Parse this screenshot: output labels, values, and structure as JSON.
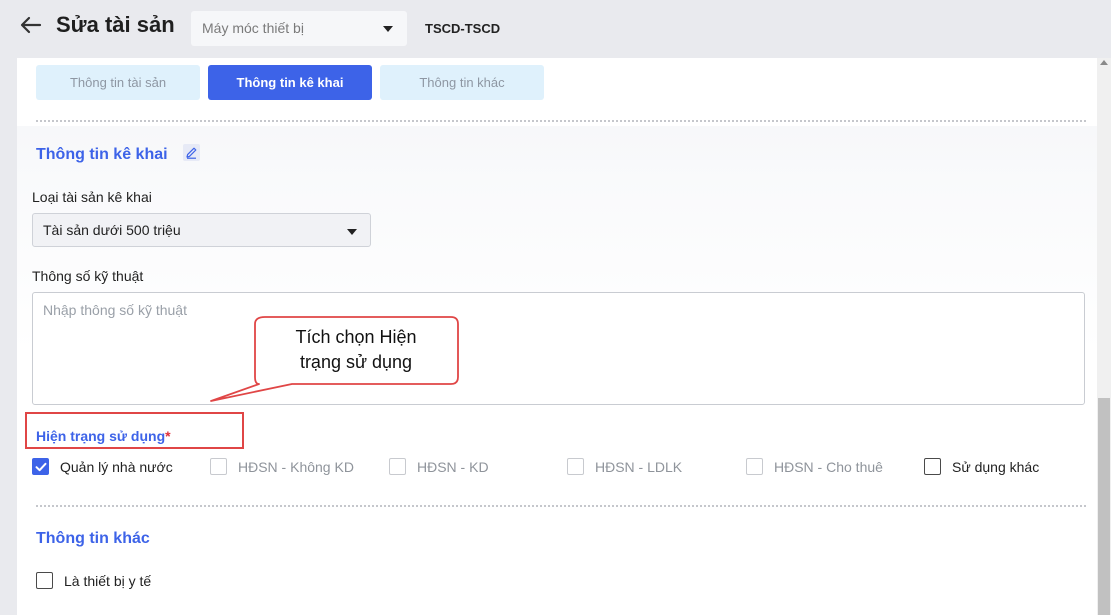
{
  "header": {
    "title": "Sửa tài sản",
    "category_value": "Máy móc thiết bị",
    "asset_code": "TSCD-TSCD"
  },
  "tabs": [
    {
      "label": "Thông tin tài sản",
      "active": false
    },
    {
      "label": "Thông tin kê khai",
      "active": true
    },
    {
      "label": "Thông tin khác",
      "active": false
    }
  ],
  "declaration": {
    "section_title": "Thông tin kê khai",
    "asset_type_label": "Loại tài sản kê khai",
    "asset_type_value": "Tài sản dưới 500 triệu",
    "spec_label": "Thông số kỹ thuật",
    "spec_placeholder": "Nhập thông số kỹ thuật",
    "status_label": "Hiện trạng sử dụng",
    "required_mark": "*",
    "status_options": [
      {
        "label": "Quản lý nhà nước",
        "checked": true,
        "enabled": true
      },
      {
        "label": "HĐSN - Không KD",
        "checked": false,
        "enabled": false
      },
      {
        "label": "HĐSN - KD",
        "checked": false,
        "enabled": false
      },
      {
        "label": "HĐSN - LDLK",
        "checked": false,
        "enabled": false
      },
      {
        "label": "HĐSN - Cho thuê",
        "checked": false,
        "enabled": false
      },
      {
        "label": "Sử dụng khác",
        "checked": false,
        "enabled": true
      }
    ]
  },
  "other": {
    "section_title": "Thông tin khác",
    "medical_device_label": "Là thiết bị y tế",
    "medical_device_checked": false
  },
  "callout": {
    "line1": "Tích chọn Hiện",
    "line2": "trạng sử dụng"
  },
  "colors": {
    "accent": "#3d63e8",
    "highlight_red": "#e04646",
    "tab_inactive_bg": "#dff1fc"
  }
}
